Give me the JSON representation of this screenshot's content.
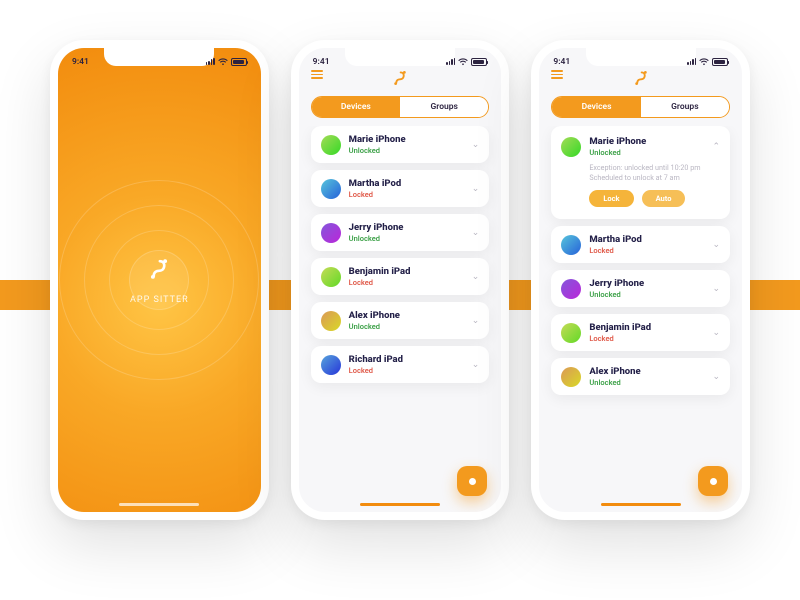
{
  "status": {
    "time": "9:41"
  },
  "splash": {
    "title": "APP SITTER"
  },
  "tabs": {
    "devices": "Devices",
    "groups": "Groups"
  },
  "statusLabels": {
    "unlocked": "Unlocked",
    "locked": "Locked"
  },
  "screen2": {
    "items": [
      {
        "name": "Marie iPhone",
        "status": "unlocked",
        "avatarHue": 85
      },
      {
        "name": "Martha iPod",
        "status": "locked",
        "avatarHue": 190
      },
      {
        "name": "Jerry iPhone",
        "status": "unlocked",
        "avatarHue": 260
      },
      {
        "name": "Benjamin iPad",
        "status": "locked",
        "avatarHue": 70
      },
      {
        "name": "Alex iPhone",
        "status": "unlocked",
        "avatarHue": 30
      },
      {
        "name": "Richard iPad",
        "status": "locked",
        "avatarHue": 205
      }
    ]
  },
  "screen3": {
    "expanded": {
      "name": "Marie iPhone",
      "status": "unlocked",
      "avatarHue": 85,
      "line1": "Exception: unlocked until 10:20 pm",
      "line2": "Scheduled to unlock at 7 am",
      "lockLabel": "Lock",
      "autoLabel": "Auto"
    },
    "items": [
      {
        "name": "Martha iPod",
        "status": "locked",
        "avatarHue": 190
      },
      {
        "name": "Jerry iPhone",
        "status": "unlocked",
        "avatarHue": 260
      },
      {
        "name": "Benjamin iPad",
        "status": "locked",
        "avatarHue": 70
      },
      {
        "name": "Alex iPhone",
        "status": "unlocked",
        "avatarHue": 30
      }
    ]
  }
}
